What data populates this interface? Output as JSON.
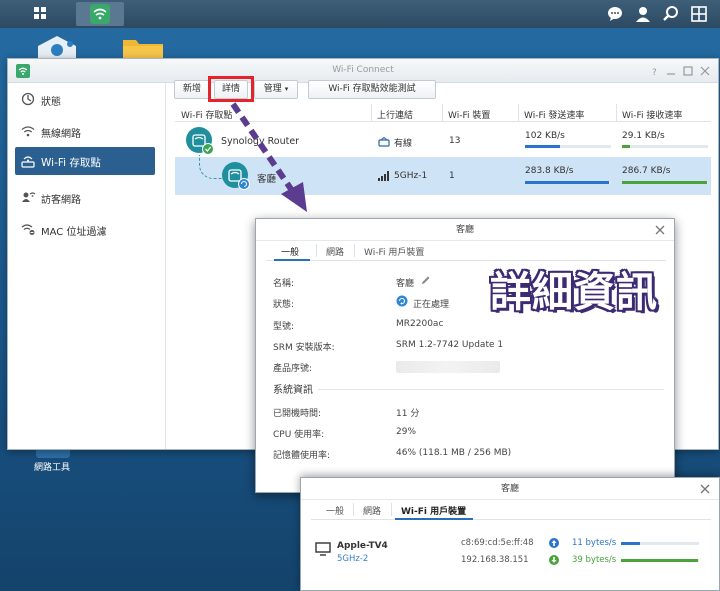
{
  "desktop": {
    "launcher_label": "網路工具"
  },
  "window": {
    "title": "Wi-Fi Connect",
    "sidebar": [
      {
        "label": "狀態",
        "icon": "status-icon"
      },
      {
        "label": "無線網路",
        "icon": "wireless-icon"
      },
      {
        "label": "Wi-Fi 存取點",
        "icon": "access-point-icon",
        "active": true
      },
      {
        "label": "訪客網路",
        "icon": "guest-network-icon"
      },
      {
        "label": "MAC 位址過濾",
        "icon": "mac-filter-icon"
      }
    ],
    "toolbar": {
      "add": "新增",
      "details": "詳情",
      "manage": "管理",
      "speedtest": "Wi-Fi 存取點效能測試"
    },
    "columns": [
      "Wi-Fi 存取點",
      "上行連結",
      "Wi-Fi 裝置",
      "Wi-Fi 發送速率",
      "Wi-Fi 接收速率"
    ],
    "rows": [
      {
        "name": "Synology Router",
        "uplink": "有線",
        "devices": "13",
        "tx": "102 KB/s",
        "rx": "29.1 KB/s",
        "tx_level": 0.41,
        "rx_level": 0.09
      },
      {
        "name": "客廳",
        "uplink": "5GHz-1",
        "devices": "1",
        "tx": "283.8 KB/s",
        "rx": "286.7 KB/s",
        "tx_level": 0.98,
        "rx_level": 0.99
      }
    ]
  },
  "detail_dialog": {
    "title": "客廳",
    "tabs": [
      "一般",
      "網路",
      "Wi-Fi 用戶裝置"
    ],
    "fields": {
      "name_label": "名稱:",
      "name_value": "客廳",
      "status_label": "狀態:",
      "status_value": "正在處理",
      "model_label": "型號:",
      "model_value": "MR2200ac",
      "srm_label": "SRM 安裝版本:",
      "srm_value": "SRM 1.2-7742 Update 1",
      "serial_label": "產品序號:"
    },
    "system_title": "系統資訊",
    "system": {
      "uptime_label": "已開機時間:",
      "uptime_value": "11 分",
      "cpu_label": "CPU 使用率:",
      "cpu_value": "29%",
      "mem_label": "記憶體使用率:",
      "mem_value": "46% (118.1 MB / 256 MB)"
    },
    "annotation": "詳細資訊"
  },
  "devices_dialog": {
    "title": "客廳",
    "tabs": [
      "一般",
      "網路",
      "Wi-Fi 用戶裝置"
    ],
    "device": {
      "name": "Apple-TV4",
      "band": "5GHz-2",
      "mac": "c8:69:cd:5e:ff:48",
      "ip": "192.168.38.151",
      "upload": "11 bytes/s",
      "download": "39 bytes/s",
      "upload_level": 0.24,
      "download_level": 0.99
    }
  },
  "colors": {
    "accent": "#2a5f8f",
    "tx_bar": "#2a74c9",
    "rx_bar": "#4aa33b",
    "highlight": "#e4232a",
    "arrow": "#5b3c8f"
  }
}
